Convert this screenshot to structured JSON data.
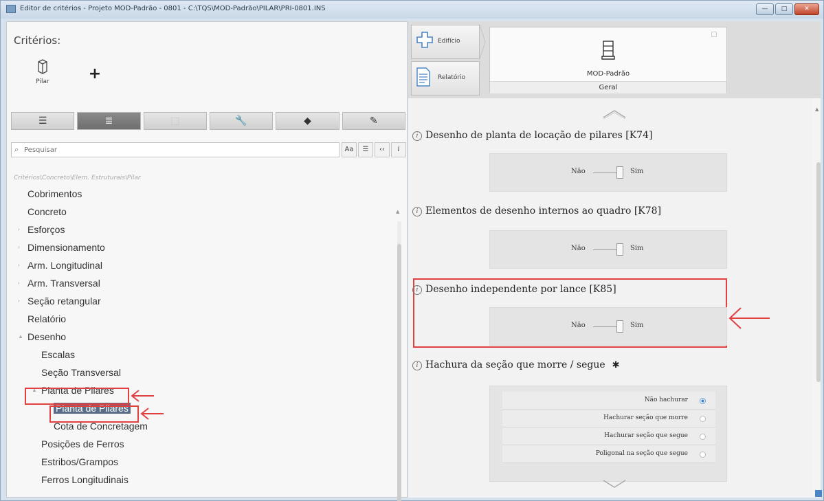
{
  "window": {
    "title": "Editor de critérios - Projeto MOD-Padrão - 0801 - C:\\TQS\\MOD-Padrão\\PILAR\\PRI-0801.INS",
    "buttons": {
      "minimize": "—",
      "maximize": "□",
      "close": "✕"
    }
  },
  "left": {
    "heading": "Critérios:",
    "pilar_label": "Pilar",
    "add_label": "+",
    "toolbar": [
      "☰",
      "≣",
      "⬚",
      "🔧",
      "◆",
      "✎"
    ],
    "search": {
      "placeholder": "Pesquisar",
      "opts": [
        "Aa",
        "☰",
        "‹‹",
        "i"
      ]
    },
    "breadcrumb": "Critérios\\Concreto\\Elem. Estruturais\\Pilar",
    "tree": [
      {
        "label": "Cobrimentos",
        "level": 0,
        "arrow": ""
      },
      {
        "label": "Concreto",
        "level": 0,
        "arrow": ""
      },
      {
        "label": "Esforços",
        "level": 0,
        "arrow": "›"
      },
      {
        "label": "Dimensionamento",
        "level": 0,
        "arrow": "›"
      },
      {
        "label": "Arm. Longitudinal",
        "level": 0,
        "arrow": "›"
      },
      {
        "label": "Arm. Transversal",
        "level": 0,
        "arrow": "›"
      },
      {
        "label": "Seção retangular",
        "level": 0,
        "arrow": "›"
      },
      {
        "label": "Relatório",
        "level": 0,
        "arrow": ""
      },
      {
        "label": "Desenho",
        "level": 0,
        "arrow": "▲"
      },
      {
        "label": "Escalas",
        "level": 1,
        "arrow": ""
      },
      {
        "label": "Seção Transversal",
        "level": 1,
        "arrow": ""
      },
      {
        "label": "Planta de Pilares",
        "level": 1,
        "arrow": "▲"
      },
      {
        "label": "Planta de Pilares",
        "level": 2,
        "arrow": "",
        "selected": true
      },
      {
        "label": "Cota de Concretagem",
        "level": 2,
        "arrow": ""
      },
      {
        "label": "Posições de Ferros",
        "level": 1,
        "arrow": ""
      },
      {
        "label": "Estribos/Grampos",
        "level": 1,
        "arrow": ""
      },
      {
        "label": "Ferros Longitudinais",
        "level": 1,
        "arrow": ""
      }
    ]
  },
  "right": {
    "nav": {
      "edificio": "Edifício",
      "relatorio": "Relatório"
    },
    "card": {
      "name": "MOD-Padrão",
      "sub": "Geral"
    },
    "criteria": [
      {
        "label": "Desenho de planta de locação de pilares [K74]",
        "nao": "Não",
        "sim": "Sim"
      },
      {
        "label": "Elementos de desenho internos ao quadro [K78]",
        "nao": "Não",
        "sim": "Sim"
      },
      {
        "label": "Desenho independente por lance [K85]",
        "nao": "Não",
        "sim": "Sim"
      }
    ],
    "hachura": {
      "label": "Hachura da seção que morre / segue",
      "star": "✱",
      "options": [
        {
          "label": "Não hachurar",
          "selected": true
        },
        {
          "label": "Hachurar seção que morre",
          "selected": false
        },
        {
          "label": "Hachurar seção que segue",
          "selected": false
        },
        {
          "label": "Poligonal na seção que segue",
          "selected": false
        }
      ]
    }
  },
  "colors": {
    "highlight": "#e04040",
    "selected_row": "#5a6d86",
    "radio_on": "#3c7fc9"
  }
}
